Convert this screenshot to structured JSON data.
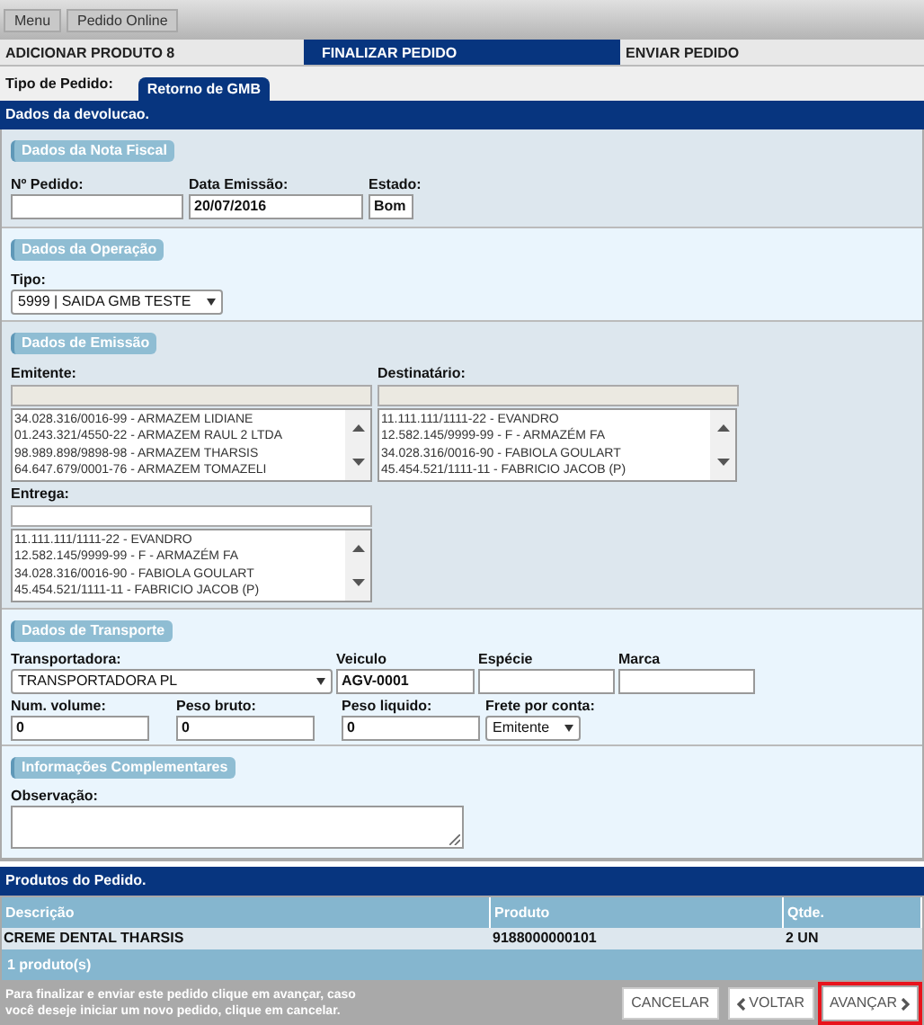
{
  "breadcrumb": [
    "Menu",
    "Pedido Online"
  ],
  "steps": [
    {
      "label": "ADICIONAR PRODUTO 8",
      "selected": false
    },
    {
      "label": "FINALIZAR PEDIDO",
      "selected": true
    },
    {
      "label": "ENVIAR PEDIDO",
      "selected": false
    }
  ],
  "order_type": {
    "label": "Tipo de Pedido:",
    "tabs": [
      {
        "label": "Retorno de GMB",
        "selected": true
      }
    ]
  },
  "header": "Dados da devolucao.",
  "nota_fiscal": {
    "title": "Dados da Nota Fiscal",
    "pedido": {
      "label": "Nº Pedido:"
    },
    "data_emissao": {
      "label": "Data Emissão:",
      "value": "20/07/2016"
    },
    "estado": {
      "label": "Estado:",
      "value": "Bom"
    }
  },
  "operacao": {
    "title": "Dados da Operação",
    "tipo": {
      "label": "Tipo:",
      "value": "5999 | SAIDA GMB TESTE"
    }
  },
  "emissao": {
    "title": "Dados de Emissão",
    "emitente": {
      "label": "Emitente:",
      "items": [
        "34.028.316/0016-99 - ARMAZEM LIDIANE",
        "01.243.321/4550-22 - ARMAZEM RAUL 2 LTDA",
        "98.989.898/9898-98 - ARMAZEM THARSIS",
        "64.647.679/0001-76 - ARMAZEM TOMAZELI"
      ]
    },
    "destinatario": {
      "label": "Destinatário:",
      "items": [
        "11.111.111/1111-22 - EVANDRO",
        "12.582.145/9999-99 - F - ARMAZÉM FA",
        "34.028.316/0016-90 - FABIOLA GOULART",
        "45.454.521/1111-11 - FABRICIO JACOB (P)"
      ]
    },
    "entrega": {
      "label": "Entrega:",
      "items": [
        "11.111.111/1111-22 - EVANDRO",
        "12.582.145/9999-99 - F - ARMAZÉM FA",
        "34.028.316/0016-90 - FABIOLA GOULART",
        "45.454.521/1111-11 - FABRICIO JACOB (P)"
      ]
    }
  },
  "transporte": {
    "title": "Dados de Transporte",
    "transportadora": {
      "label": "Transportadora:",
      "value": "TRANSPORTADORA PL"
    },
    "veiculo": {
      "label": "Veiculo",
      "value": "AGV-0001"
    },
    "especie": {
      "label": "Espécie"
    },
    "marca": {
      "label": "Marca"
    },
    "num_volume": {
      "label": "Num. volume:",
      "value": "0"
    },
    "peso_bruto": {
      "label": "Peso bruto:",
      "value": "0"
    },
    "peso_liquido": {
      "label": "Peso liquido:",
      "value": "0"
    },
    "frete": {
      "label": "Frete por conta:",
      "value": "Emitente"
    }
  },
  "complementares": {
    "title": "Informações Complementares",
    "observacao": {
      "label": "Observação:"
    }
  },
  "produtos": {
    "title": "Produtos do Pedido.",
    "columns": [
      "Descrição",
      "Produto",
      "Qtde."
    ],
    "rows": [
      [
        "CREME DENTAL THARSIS",
        "9188000000101",
        "2 UN"
      ]
    ],
    "footer": "1 produto(s)"
  },
  "instructions": "Para finalizar e enviar este pedido clique em avançar, caso você deseje iniciar um novo pedido, clique em cancelar.",
  "buttons": [
    {
      "label": "CANCELAR",
      "kind": "plain",
      "highlighted": false
    },
    {
      "label": "VOLTAR",
      "kind": "back",
      "highlighted": false
    },
    {
      "label": "AVANÇAR",
      "kind": "next",
      "highlighted": true
    }
  ]
}
